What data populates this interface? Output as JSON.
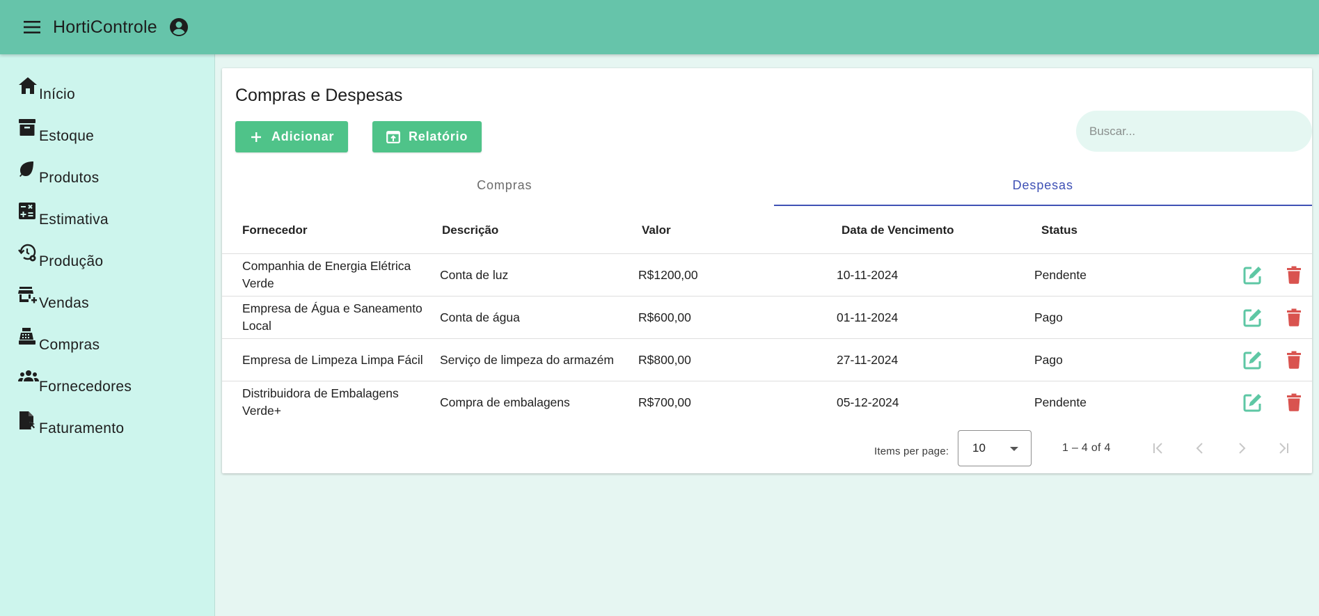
{
  "app": {
    "title": "HortiControle"
  },
  "sidebar": {
    "items": [
      {
        "label": "Início",
        "icon": "home-icon"
      },
      {
        "label": "Estoque",
        "icon": "archive-icon"
      },
      {
        "label": "Produtos",
        "icon": "leaf-icon"
      },
      {
        "label": "Estimativa",
        "icon": "calculator-icon"
      },
      {
        "label": "Produção",
        "icon": "history-gear-icon"
      },
      {
        "label": "Vendas",
        "icon": "store-add-icon"
      },
      {
        "label": "Compras",
        "icon": "cash-register-icon"
      },
      {
        "label": "Fornecedores",
        "icon": "group-icon"
      },
      {
        "label": "Faturamento",
        "icon": "file-pointer-icon"
      }
    ]
  },
  "page": {
    "title": "Compras e Despesas",
    "add_label": "Adicionar",
    "report_label": "Relatório",
    "search_placeholder": "Buscar...",
    "tabs": [
      {
        "label": "Compras",
        "active": false
      },
      {
        "label": "Despesas",
        "active": true
      }
    ]
  },
  "table": {
    "headers": [
      "Fornecedor",
      "Descrição",
      "Valor",
      "Data de Vencimento",
      "Status"
    ],
    "rows": [
      {
        "fornecedor": "Companhia de Energia Elétrica Verde",
        "descricao": "Conta de luz",
        "valor": "R$1200,00",
        "data": "10-11-2024",
        "status": "Pendente"
      },
      {
        "fornecedor": "Empresa de Água e Saneamento Local",
        "descricao": "Conta de água",
        "valor": "R$600,00",
        "data": "01-11-2024",
        "status": "Pago"
      },
      {
        "fornecedor": "Empresa de Limpeza Limpa Fácil",
        "descricao": "Serviço de limpeza do armazém",
        "valor": "R$800,00",
        "data": "27-11-2024",
        "status": "Pago"
      },
      {
        "fornecedor": "Distribuidora de Embalagens Verde+",
        "descricao": "Compra de embalagens",
        "valor": "R$700,00",
        "data": "05-12-2024",
        "status": "Pendente"
      }
    ]
  },
  "paginator": {
    "items_per_page_label": "Items per page:",
    "page_size": "10",
    "range": "1 – 4 of 4"
  },
  "colors": {
    "topbar": "#66c4aa",
    "sidebar": "#cdf5ed",
    "button": "#4fc389",
    "active_tab": "#3f51b5",
    "edit_icon": "#5ec7a4",
    "delete_icon": "#d9534f"
  }
}
